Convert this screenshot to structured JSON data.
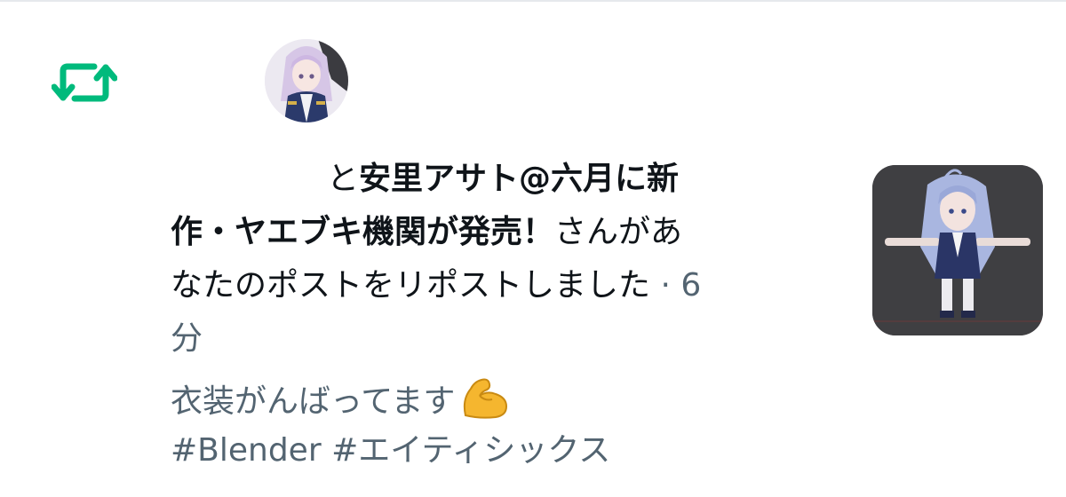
{
  "notification": {
    "icon": "repost-icon",
    "accent_color": "#00ba7c",
    "avatar": "user-avatar",
    "line1_prefix": "と",
    "line1_bold": "安里アサト@六月に新",
    "line2_bold": "作・ヤエブキ機関が発売！",
    "line2_regular": "さんがあ",
    "line3_regular": "なたのポストをリポストしました",
    "line3_time": " · 6",
    "line4_time": "分",
    "quoted_line1": "衣装がんばってます",
    "quoted_emoji": "flexed-biceps-emoji",
    "quoted_line2": "#Blender #エイティシックス",
    "thumbnail": "3d-character-model-thumbnail"
  }
}
